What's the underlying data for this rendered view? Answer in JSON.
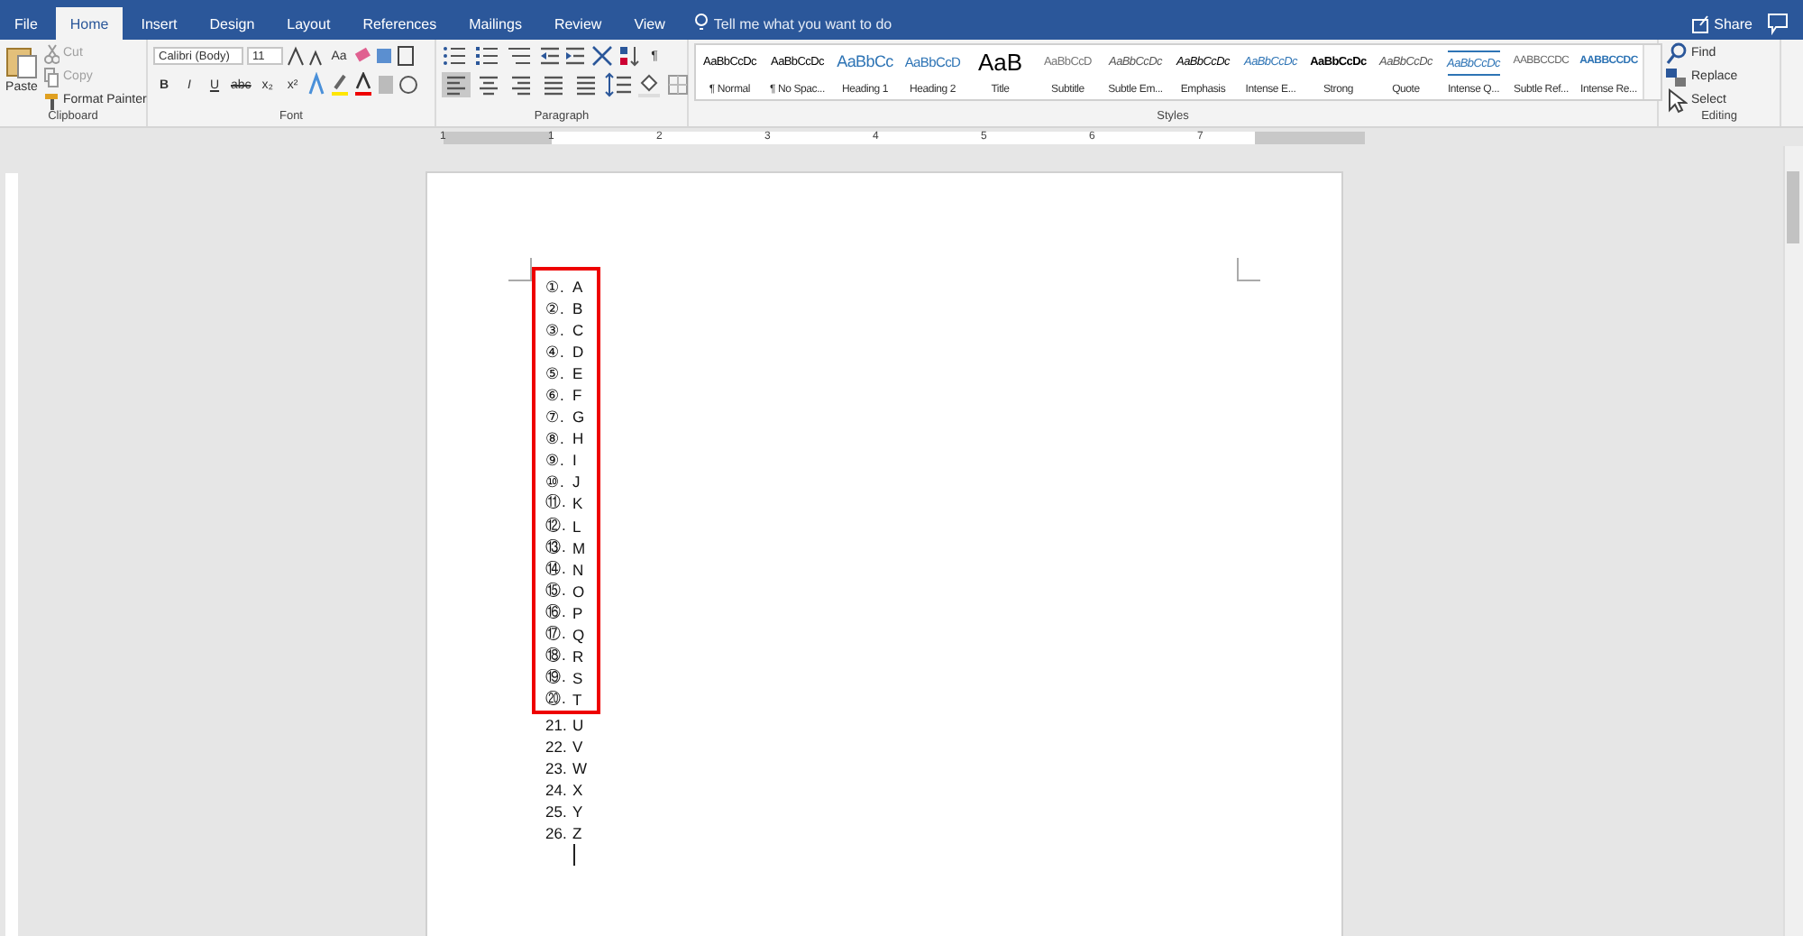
{
  "tabs": [
    {
      "label": "File",
      "selected": false
    },
    {
      "label": "Home",
      "selected": true
    },
    {
      "label": "Insert",
      "selected": false
    },
    {
      "label": "Design",
      "selected": false
    },
    {
      "label": "Layout",
      "selected": false
    },
    {
      "label": "References",
      "selected": false
    },
    {
      "label": "Mailings",
      "selected": false
    },
    {
      "label": "Review",
      "selected": false
    },
    {
      "label": "View",
      "selected": false
    }
  ],
  "tell_me": {
    "placeholder": "Tell me what you want to do"
  },
  "share": "Share",
  "clipboard": {
    "paste": "Paste",
    "items": [
      {
        "label": "Cut",
        "disabled": true
      },
      {
        "label": "Copy",
        "disabled": true
      },
      {
        "label": "Format Painter",
        "disabled": false
      }
    ],
    "label": "Clipboard"
  },
  "font": {
    "name": "Calibri (Body)",
    "size": "11",
    "change_case": "Aa",
    "format_buttons": [
      "B",
      "I",
      "U",
      "abc",
      "x₂",
      "x²"
    ],
    "label": "Font"
  },
  "paragraph": {
    "label": "Paragraph",
    "show_marks": "¶",
    "alignments": [
      {
        "kind": "left",
        "selected": true
      },
      {
        "kind": "center",
        "selected": false
      },
      {
        "kind": "right",
        "selected": false
      },
      {
        "kind": "justify",
        "selected": false
      },
      {
        "kind": "distribute",
        "selected": false
      }
    ]
  },
  "styles": {
    "label": "Styles",
    "items": [
      {
        "preview": "AaBbCcDc",
        "name": "¶ Normal",
        "kind": "plain"
      },
      {
        "preview": "AaBbCcDc",
        "name": "¶ No Spac...",
        "kind": "plain"
      },
      {
        "preview": "AaBbCc",
        "name": "Heading 1",
        "kind": "heading1"
      },
      {
        "preview": "AaBbCcD",
        "name": "Heading 2",
        "kind": "heading2"
      },
      {
        "preview": "AaB",
        "name": "Title",
        "kind": "title"
      },
      {
        "preview": "AaBbCcD",
        "name": "Subtitle",
        "kind": "subtle"
      },
      {
        "preview": "AaBbCcDc",
        "name": "Subtle Em...",
        "kind": "italic"
      },
      {
        "preview": "AaBbCcDc",
        "name": "Emphasis",
        "kind": "italic-dark"
      },
      {
        "preview": "AaBbCcDc",
        "name": "Intense E...",
        "kind": "intense"
      },
      {
        "preview": "AaBbCcDc",
        "name": "Strong",
        "kind": "strong"
      },
      {
        "preview": "AaBbCcDc",
        "name": "Quote",
        "kind": "italic"
      },
      {
        "preview": "AaBbCcDc",
        "name": "Intense Q...",
        "kind": "intense-quote"
      },
      {
        "preview": "AABBCCDC",
        "name": "Subtle Ref...",
        "kind": "subtle-caps"
      },
      {
        "preview": "AABBCCDC",
        "name": "Intense Re...",
        "kind": "intense-caps"
      }
    ]
  },
  "editing": {
    "label": "Editing",
    "items": [
      {
        "label": "Find",
        "kind": "find"
      },
      {
        "label": "Replace",
        "kind": "replace"
      },
      {
        "label": "Select",
        "kind": "select"
      }
    ]
  },
  "ruler": {
    "labels": [
      "1",
      "1",
      "2",
      "3",
      "4",
      "5",
      "6",
      "7"
    ]
  },
  "document": {
    "boxed_list": [
      {
        "number": "①.",
        "text": "A"
      },
      {
        "number": "②.",
        "text": "B"
      },
      {
        "number": "③.",
        "text": "C"
      },
      {
        "number": "④.",
        "text": "D"
      },
      {
        "number": "⑤.",
        "text": "E"
      },
      {
        "number": "⑥.",
        "text": "F"
      },
      {
        "number": "⑦.",
        "text": "G"
      },
      {
        "number": "⑧.",
        "text": "H"
      },
      {
        "number": "⑨.",
        "text": "I"
      },
      {
        "number": "⑩.",
        "text": "J"
      },
      {
        "number": "⑪.",
        "text": "K"
      },
      {
        "number": "⑫.",
        "text": "L"
      },
      {
        "number": "⑬.",
        "text": "M"
      },
      {
        "number": "⑭.",
        "text": "N"
      },
      {
        "number": "⑮.",
        "text": "O"
      },
      {
        "number": "⑯.",
        "text": "P"
      },
      {
        "number": "⑰.",
        "text": "Q"
      },
      {
        "number": "⑱.",
        "text": "R"
      },
      {
        "number": "⑲.",
        "text": "S"
      },
      {
        "number": "⑳.",
        "text": "T"
      }
    ],
    "list": [
      {
        "number": "21.",
        "text": "U"
      },
      {
        "number": "22.",
        "text": "V"
      },
      {
        "number": "23.",
        "text": "W"
      },
      {
        "number": "24.",
        "text": "X"
      },
      {
        "number": "25.",
        "text": "Y"
      },
      {
        "number": "26.",
        "text": "Z"
      }
    ]
  }
}
